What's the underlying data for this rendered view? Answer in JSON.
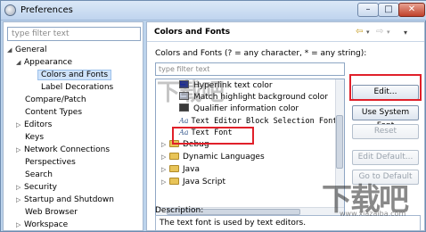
{
  "window": {
    "title": "Preferences",
    "min_glyph": "–",
    "max_glyph": "□",
    "close_glyph": "✕"
  },
  "left": {
    "filter_placeholder": "type filter text",
    "tree": [
      {
        "label": "General",
        "arrow": "◢"
      },
      {
        "label": "Appearance",
        "arrow": "◢"
      },
      {
        "label": "Colors and Fonts",
        "arrow": "",
        "selected": true
      },
      {
        "label": "Label Decorations",
        "arrow": ""
      },
      {
        "label": "Compare/Patch",
        "arrow": ""
      },
      {
        "label": "Content Types",
        "arrow": ""
      },
      {
        "label": "Editors",
        "arrow": "▷"
      },
      {
        "label": "Keys",
        "arrow": ""
      },
      {
        "label": "Network Connections",
        "arrow": "▷"
      },
      {
        "label": "Perspectives",
        "arrow": ""
      },
      {
        "label": "Search",
        "arrow": ""
      },
      {
        "label": "Security",
        "arrow": "▷"
      },
      {
        "label": "Startup and Shutdown",
        "arrow": "▷"
      },
      {
        "label": "Web Browser",
        "arrow": ""
      },
      {
        "label": "Workspace",
        "arrow": "▷"
      }
    ]
  },
  "right": {
    "title": "Colors and Fonts",
    "nav": {
      "back": "⇦",
      "dropdown": "▾",
      "forward": "⇨",
      "menu": "▾"
    },
    "description": "Colors and Fonts (? = any character, * = any string):",
    "filter_placeholder": "type filter text",
    "items": [
      {
        "kind": "color",
        "label": "Hyperlink text color",
        "color": "#1a2a9a"
      },
      {
        "kind": "color",
        "label": "Match highlight background color",
        "color": "#c8d0e0"
      },
      {
        "kind": "color",
        "label": "Qualifier information color",
        "color": "#3a3a3a"
      },
      {
        "kind": "font",
        "label": "Text Editor Block Selection Font",
        "aa": "Aa"
      },
      {
        "kind": "font",
        "label": "Text Font",
        "aa": "Aa"
      },
      {
        "kind": "folder",
        "label": "Debug"
      },
      {
        "kind": "folder",
        "label": "Dynamic Languages"
      },
      {
        "kind": "folder",
        "label": "Java"
      },
      {
        "kind": "folder",
        "label": "Java Script"
      }
    ],
    "buttons": {
      "edit": "Edit...",
      "use_system_font": "Use System Font",
      "reset": "Reset",
      "edit_default": "Edit Default...",
      "go_to_default": "Go to Default"
    },
    "desc_label": "Description:",
    "desc_text": "The text font is used by text editors."
  },
  "watermark": {
    "text": "下载吧",
    "url": "www.xiazaiba.com",
    "overlay_text": "下载吧"
  },
  "highlight_color": "#e0202a"
}
